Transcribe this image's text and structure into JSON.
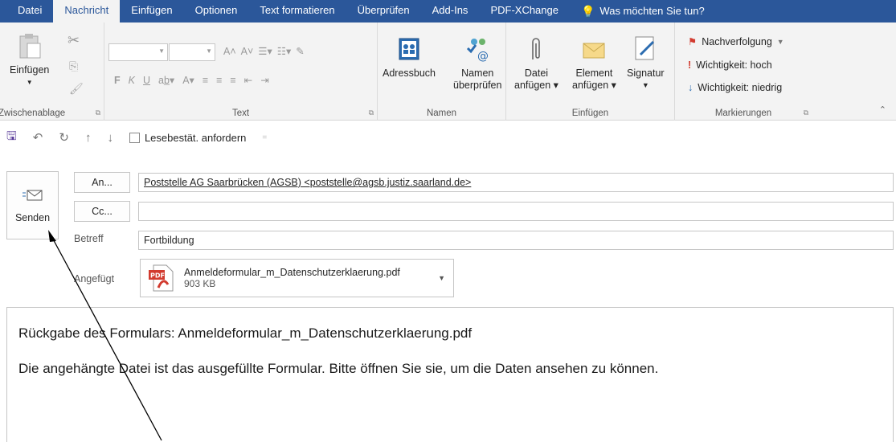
{
  "tabs": [
    {
      "label": "Datei"
    },
    {
      "label": "Nachricht"
    },
    {
      "label": "Einfügen"
    },
    {
      "label": "Optionen"
    },
    {
      "label": "Text formatieren"
    },
    {
      "label": "Überprüfen"
    },
    {
      "label": "Add-Ins"
    },
    {
      "label": "PDF-XChange"
    },
    {
      "label": "Was möchten Sie tun?"
    }
  ],
  "ribbon": {
    "clipboard": {
      "paste_label": "Einfügen",
      "group_label": "Zwischenablage"
    },
    "text": {
      "group_label": "Text",
      "bold": "F",
      "italic": "K",
      "underline": "U"
    },
    "names": {
      "addressbook_label": "Adressbuch",
      "checknames_label1": "Namen",
      "checknames_label2": "überprüfen",
      "group_label": "Namen"
    },
    "insert": {
      "attachfile_label1": "Datei",
      "attachfile_label2": "anfügen",
      "attachitem_label1": "Element",
      "attachitem_label2": "anfügen",
      "signature_label": "Signatur",
      "group_label": "Einfügen"
    },
    "tags": {
      "followup_label": "Nachverfolgung",
      "high_label": "Wichtigkeit: hoch",
      "low_label": "Wichtigkeit: niedrig",
      "group_label": "Markierungen"
    }
  },
  "qat": {
    "readreceipt_label": "Lesebestät. anfordern"
  },
  "compose": {
    "send_label": "Senden",
    "to_button": "An...",
    "cc_button": "Cc...",
    "to_value": "Poststelle AG Saarbrücken (AGSB) <poststelle@agsb.justiz.saarland.de>",
    "cc_value": "",
    "subject_label": "Betreff",
    "subject_value": "Fortbildung",
    "attached_label": "Angefügt",
    "attachment_name": "Anmeldeformular_m_Datenschutzerklaerung.pdf",
    "attachment_size": "903 KB",
    "pdf_badge": "PDF"
  },
  "body": {
    "line1": "Rückgabe des Formulars: Anmeldeformular_m_Datenschutzerklaerung.pdf",
    "line2": "Die angehängte Datei ist das ausgefüllte Formular. Bitte öffnen Sie sie, um die Daten ansehen zu können."
  },
  "colors": {
    "accent": "#2b579a",
    "ribbon_bg": "#f3f3f3",
    "pdf_red": "#d23b2f"
  }
}
